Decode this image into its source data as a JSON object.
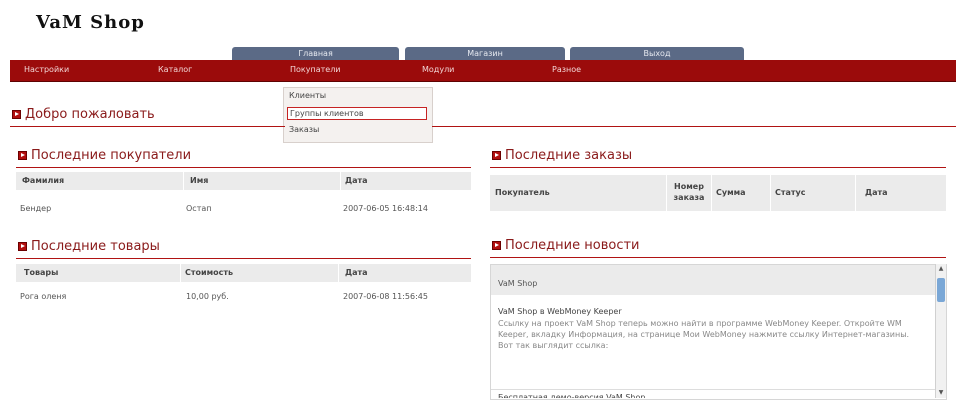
{
  "logo": "VaM Shop",
  "top_tabs": [
    "Главная",
    "Магазин",
    "Выход"
  ],
  "menu": [
    "Настройки",
    "Каталог",
    "Покупатели",
    "Модули",
    "Разное"
  ],
  "dropdown": [
    "Клиенты",
    "Группы клиентов",
    "Заказы"
  ],
  "welcome": "Добро пожаловать",
  "customers": {
    "title": "Последние покупатели",
    "columns": [
      "Фамилия",
      "Имя",
      "Дата"
    ],
    "rows": [
      [
        "Бендер",
        "Остап",
        "2007-06-05 16:48:14"
      ]
    ]
  },
  "products": {
    "title": "Последние товары",
    "columns": [
      "Товары",
      "Стоимость",
      "Дата"
    ],
    "rows": [
      [
        "Рога оленя",
        "10,00 руб.",
        "2007-06-08 11:56:45"
      ]
    ]
  },
  "orders": {
    "title": "Последние заказы",
    "columns": [
      "Покупатель",
      "Номер заказа",
      "Сумма",
      "Статус",
      "Дата"
    ]
  },
  "news": {
    "title": "Последние новости",
    "header": "VaM Shop",
    "item1_title": "VaM Shop в WebMoney Keeper",
    "item1_text": "Ссылку на проект VaM Shop теперь можно найти в программе WebMoney Keeper. Откройте WM Keeper, вкладку Информация, на странице Мои WebMoney нажмите ссылку Интернет-магазины. Вот так выглядит ссылка:",
    "item2_title": "Бесплатная демо-версия VaM Shop"
  },
  "colors": {
    "accent": "#9b0b0b",
    "tab": "#5b6a86"
  }
}
